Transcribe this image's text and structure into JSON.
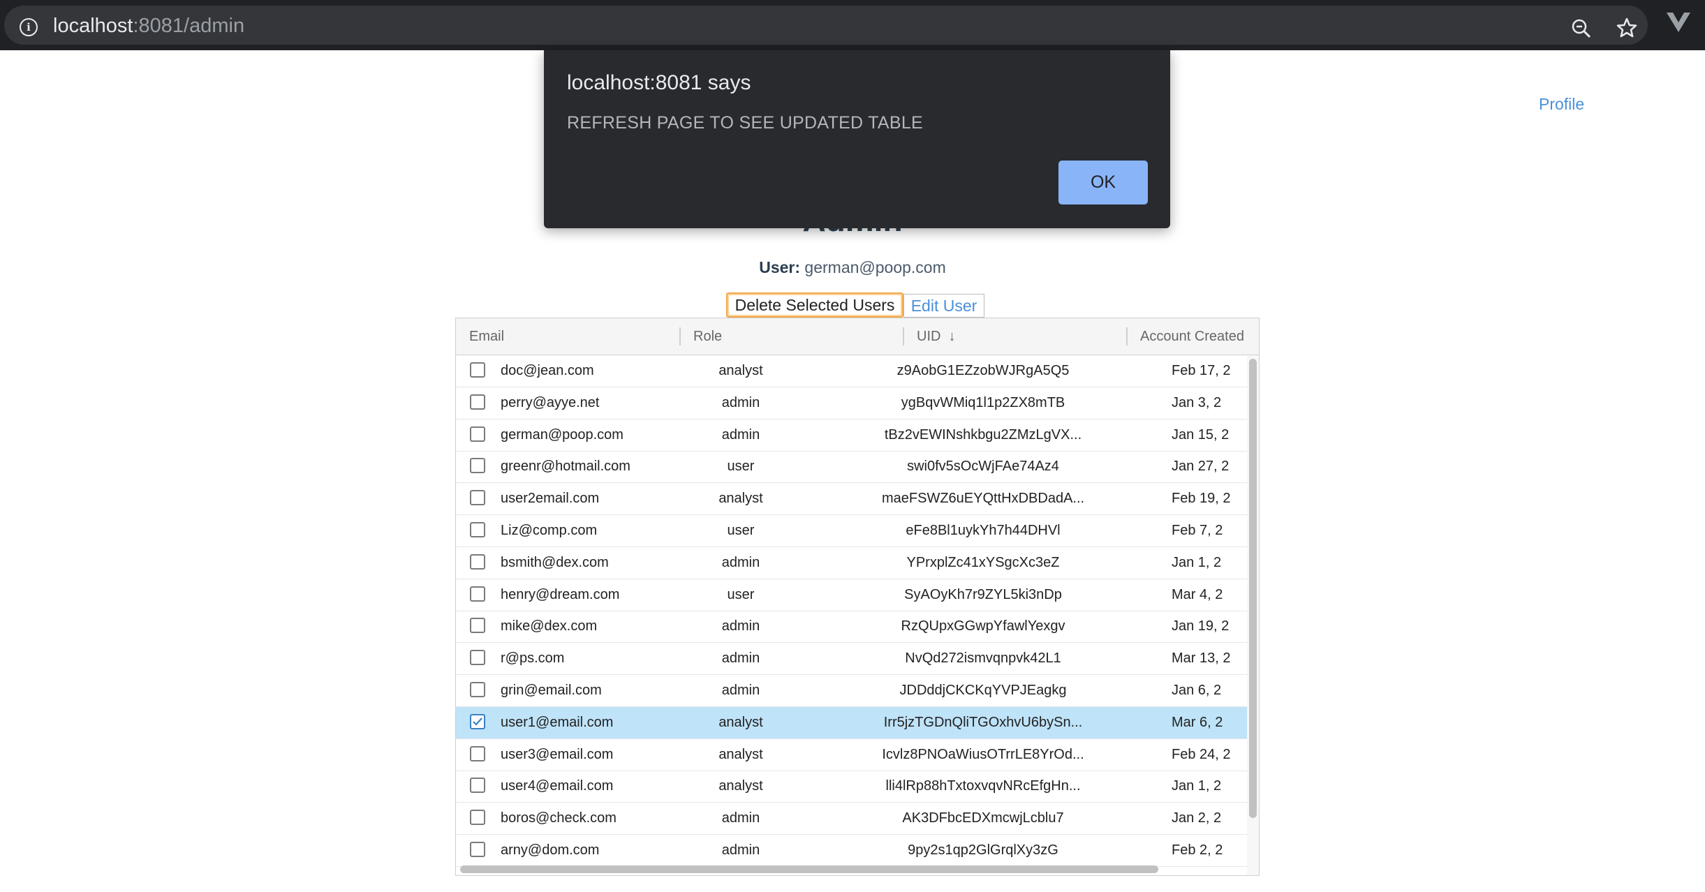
{
  "browser": {
    "url_host": "localhost",
    "url_rest": ":8081/admin"
  },
  "header": {
    "profile_label": "Profile"
  },
  "page": {
    "title": "Admin",
    "user_label": "User:",
    "user_email": "german@poop.com"
  },
  "toolbar": {
    "delete_label": "Delete Selected Users",
    "edit_label": "Edit User"
  },
  "table": {
    "columns": [
      "Email",
      "Role",
      "UID",
      "Account Created"
    ],
    "sort_indicator": "↓",
    "rows": [
      {
        "email": "doc@jean.com",
        "role": "analyst",
        "uid": "z9AobG1EZzobWJRgA5Q5",
        "created": "Feb 17, 2",
        "checked": false
      },
      {
        "email": "perry@ayye.net",
        "role": "admin",
        "uid": "ygBqvWMiq1l1p2ZX8mTB",
        "created": "Jan 3, 2",
        "checked": false
      },
      {
        "email": "german@poop.com",
        "role": "admin",
        "uid": "tBz2vEWINshkbgu2ZMzLgVX...",
        "created": "Jan 15, 2",
        "checked": false
      },
      {
        "email": "greenr@hotmail.com",
        "role": "user",
        "uid": "swi0fv5sOcWjFAe74Az4",
        "created": "Jan 27, 2",
        "checked": false
      },
      {
        "email": "user2email.com",
        "role": "analyst",
        "uid": "maeFSWZ6uEYQttHxDBDadA...",
        "created": "Feb 19, 2",
        "checked": false
      },
      {
        "email": "Liz@comp.com",
        "role": "user",
        "uid": "eFe8Bl1uykYh7h44DHVl",
        "created": "Feb 7, 2",
        "checked": false
      },
      {
        "email": "bsmith@dex.com",
        "role": "admin",
        "uid": "YPrxplZc41xYSgcXc3eZ",
        "created": "Jan 1, 2",
        "checked": false
      },
      {
        "email": "henry@dream.com",
        "role": "user",
        "uid": "SyAOyKh7r9ZYL5ki3nDp",
        "created": "Mar 4, 2",
        "checked": false
      },
      {
        "email": "mike@dex.com",
        "role": "admin",
        "uid": "RzQUpxGGwpYfawlYexgv",
        "created": "Jan 19, 2",
        "checked": false
      },
      {
        "email": "r@ps.com",
        "role": "admin",
        "uid": "NvQd272ismvqnpvk42L1",
        "created": "Mar 13, 2",
        "checked": false
      },
      {
        "email": "grin@email.com",
        "role": "admin",
        "uid": "JDDddjCKCKqYVPJEagkg",
        "created": "Jan 6, 2",
        "checked": false
      },
      {
        "email": "user1@email.com",
        "role": "analyst",
        "uid": "Irr5jzTGDnQliTGOxhvU6bySn...",
        "created": "Mar 6, 2",
        "checked": true
      },
      {
        "email": "user3@email.com",
        "role": "analyst",
        "uid": "Icvlz8PNOaWiusOTrrLE8YrOd...",
        "created": "Feb 24, 2",
        "checked": false
      },
      {
        "email": "user4@email.com",
        "role": "analyst",
        "uid": "lli4lRp88hTxtoxvqvNRcEfgHn...",
        "created": "Jan 1, 2",
        "checked": false
      },
      {
        "email": "boros@check.com",
        "role": "admin",
        "uid": "AK3DFbcEDXmcwjLcblu7",
        "created": "Jan 2, 2",
        "checked": false
      },
      {
        "email": "arny@dom.com",
        "role": "admin",
        "uid": "9py2s1qp2GlGrqlXy3zG",
        "created": "Feb 2, 2",
        "checked": false
      }
    ]
  },
  "dialog": {
    "title": "localhost:8081 says",
    "message": "REFRESH PAGE TO SEE UPDATED TABLE",
    "ok_label": "OK"
  },
  "colors": {
    "accent": "#4a90d9",
    "dialog_bg": "#292a2d",
    "ok_button": "#8ab4f8",
    "selected_row": "#bfe3f8"
  }
}
